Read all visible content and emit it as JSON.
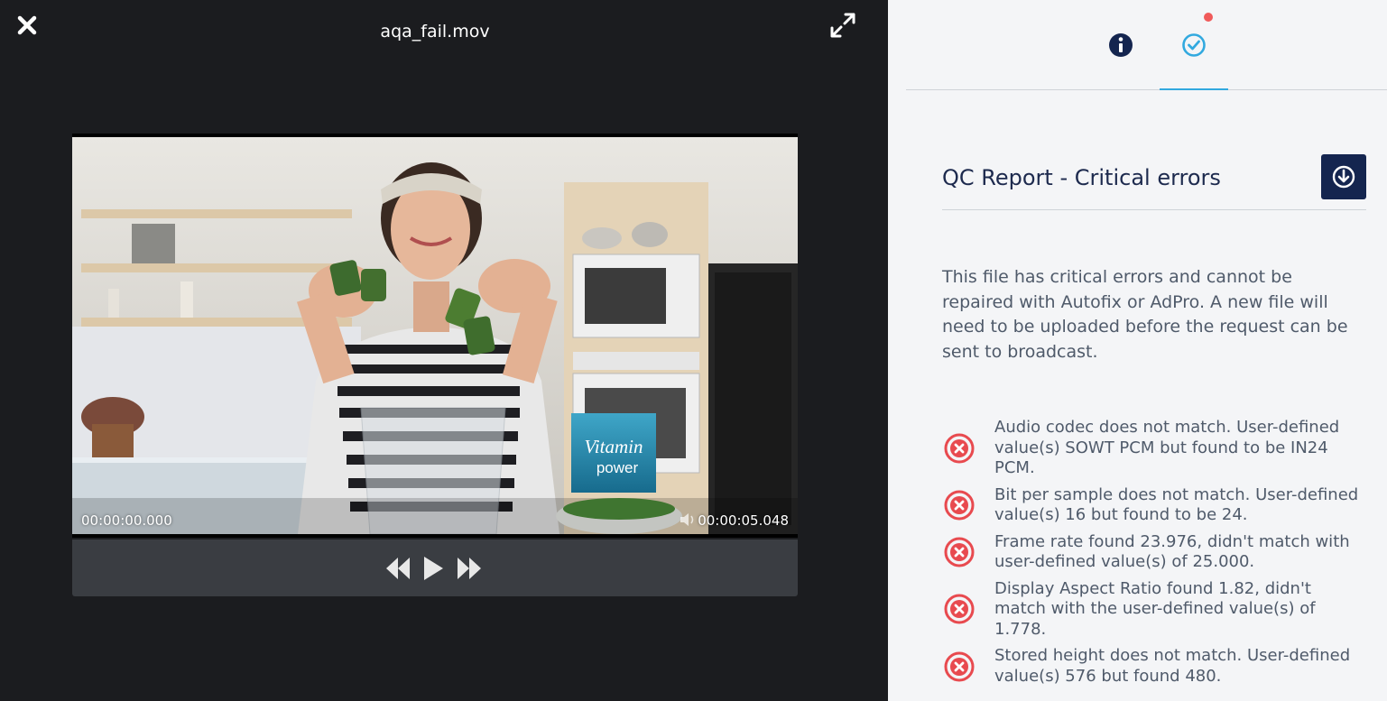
{
  "player": {
    "file_name": "aqa_fail.mov",
    "time_current": "00:00:00.000",
    "time_total": "00:00:05.048",
    "overlay_brand_line1": "Vitamin",
    "overlay_brand_line2": "power"
  },
  "tabs": [
    {
      "name": "info",
      "icon": "info-icon",
      "active": false
    },
    {
      "name": "qc",
      "icon": "check-circle-icon",
      "active": true
    }
  ],
  "report": {
    "title": "QC Report - Critical errors",
    "description": "This file has critical errors and cannot be repaired with Autofix or AdPro. A new file will need to be uploaded before the request can be sent to broadcast.",
    "errors": [
      "Audio codec does not match. User-defined value(s) SOWT PCM but found to be IN24 PCM.",
      "Bit per sample does not match. User-defined value(s) 16 but found to be 24.",
      "Frame rate found 23.976, didn't match with user-defined value(s) of 25.000.",
      "Display Aspect Ratio found 1.82, didn't match with the user-defined value(s) of 1.778.",
      "Stored height does not match. User-defined value(s) 576 but found 480."
    ]
  },
  "colors": {
    "accent": "#32a9df",
    "navy": "#14254f",
    "error": "#e84a4f",
    "notification": "#f05a5a"
  }
}
